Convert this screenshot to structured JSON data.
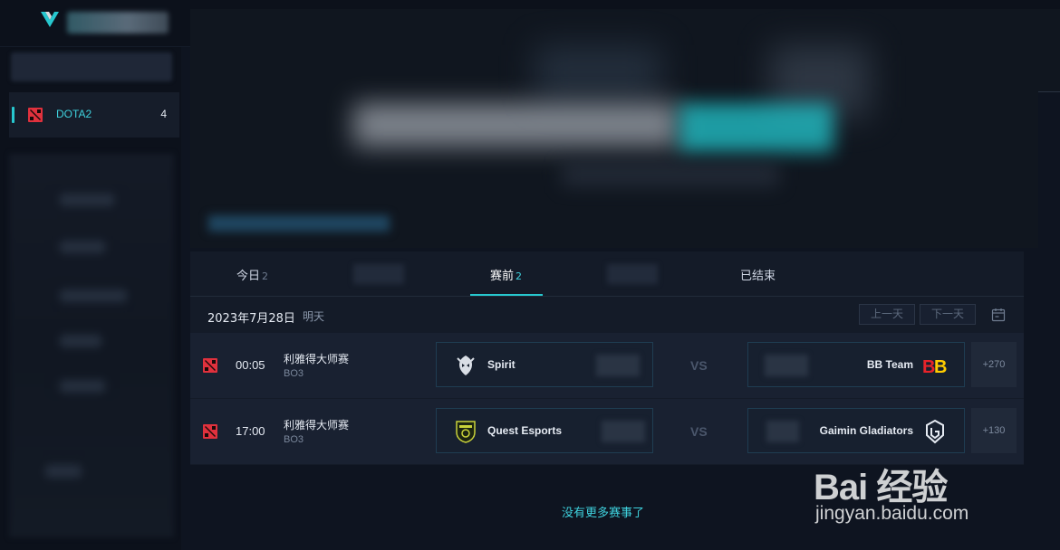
{
  "sidebar": {
    "game": {
      "label": "DOTA2",
      "count": "4"
    }
  },
  "tabs": [
    {
      "label": "今日",
      "count": "2"
    },
    {
      "label": "赛前",
      "count": "2"
    },
    {
      "label": "已结束"
    }
  ],
  "date": {
    "text": "2023年7月28日",
    "relative": "明天"
  },
  "nav": {
    "prev": "上一天",
    "next": "下一天"
  },
  "matches": [
    {
      "time": "00:05",
      "league": "利雅得大师赛",
      "format": "BO3",
      "team_a": "Spirit",
      "team_b": "BB Team",
      "vs": "VS",
      "odds": "+270"
    },
    {
      "time": "17:00",
      "league": "利雅得大师赛",
      "format": "BO3",
      "team_a": "Quest Esports",
      "team_b": "Gaimin Gladiators",
      "vs": "VS",
      "odds": "+130"
    }
  ],
  "footer": {
    "no_more": "没有更多赛事了"
  },
  "watermark": {
    "main": "Bai 经验",
    "sub": "jingyan.baidu.com"
  },
  "colors": {
    "accent": "#27c8cf",
    "dota_red": "#e0313d",
    "bb_red": "#e8232a",
    "bb_yellow": "#ffcc00"
  }
}
